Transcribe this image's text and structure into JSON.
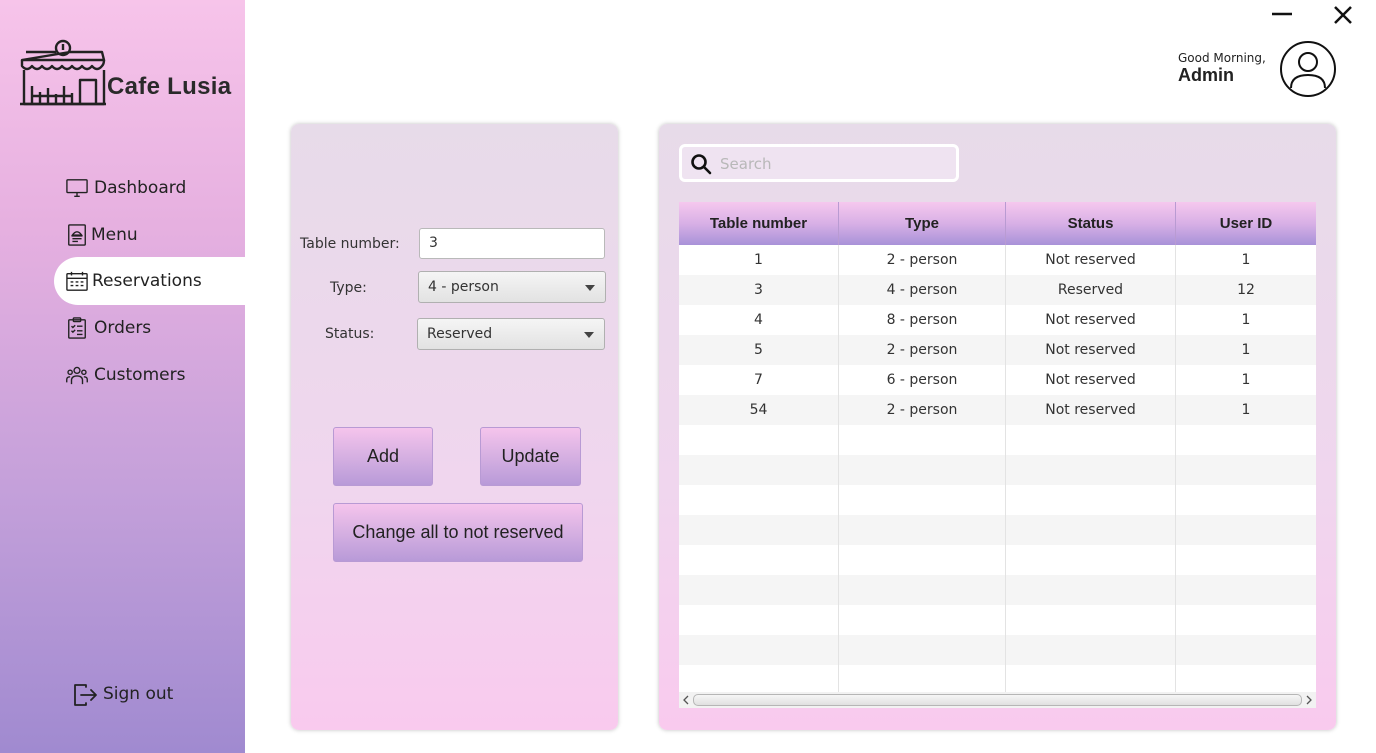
{
  "app": {
    "name": "Cafe Lusia"
  },
  "header": {
    "greeting": "Good Morning,",
    "user": "Admin"
  },
  "sidebar": {
    "items": [
      {
        "label": "Dashboard",
        "icon": "monitor-icon"
      },
      {
        "label": "Menu",
        "icon": "menu-icon"
      },
      {
        "label": "Reservations",
        "icon": "calendar-icon",
        "active": true
      },
      {
        "label": "Orders",
        "icon": "clipboard-icon"
      },
      {
        "label": "Customers",
        "icon": "users-icon"
      }
    ],
    "signout": "Sign out"
  },
  "form": {
    "table_number_label": "Table number:",
    "table_number_value": "3",
    "type_label": "Type:",
    "type_value": "4 - person",
    "status_label": "Status:",
    "status_value": "Reserved",
    "add_label": "Add",
    "update_label": "Update",
    "reset_label": "Change all to not reserved"
  },
  "search": {
    "placeholder": "Search"
  },
  "table": {
    "columns": [
      "Table number",
      "Type",
      "Status",
      "User ID"
    ],
    "rows": [
      [
        "1",
        "2 - person",
        "Not reserved",
        "1"
      ],
      [
        "3",
        "4 - person",
        "Reserved",
        "12"
      ],
      [
        "4",
        "8 - person",
        "Not reserved",
        "1"
      ],
      [
        "5",
        "2 - person",
        "Not reserved",
        "1"
      ],
      [
        "7",
        "6 - person",
        "Not reserved",
        "1"
      ],
      [
        "54",
        "2 - person",
        "Not reserved",
        "1"
      ]
    ]
  },
  "colors": {
    "sidebar_top": "#f7c4ea",
    "sidebar_bottom": "#a08ad0",
    "header_accent": "#a892d8",
    "button_accent": "#d6b0e2"
  }
}
